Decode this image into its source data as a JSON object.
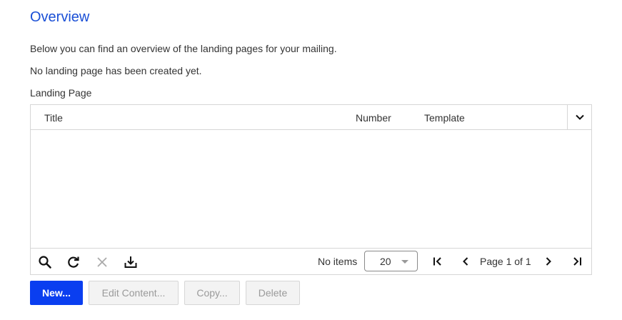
{
  "page": {
    "title": "Overview",
    "description": "Below you can find an overview of the landing pages for your mailing.",
    "empty_message": "No landing page has been created yet.",
    "grid_label": "Landing Page"
  },
  "grid": {
    "columns": [
      "Title",
      "Number",
      "Template"
    ],
    "menu_icon": "chevron-down-icon",
    "rows": []
  },
  "footer": {
    "tools": [
      "search-icon",
      "refresh-icon",
      "clear-filter-icon",
      "download-icon"
    ],
    "no_items": "No items",
    "page_size": "20",
    "page_info": "Page 1 of 1"
  },
  "actions": {
    "new_label": "New...",
    "edit_label": "Edit Content...",
    "copy_label": "Copy...",
    "delete_label": "Delete"
  },
  "colors": {
    "accent": "#1a4fd6",
    "primary_button": "#0a3ef0",
    "disabled_bg": "#f3f3f3",
    "border": "#d6d6d6"
  }
}
